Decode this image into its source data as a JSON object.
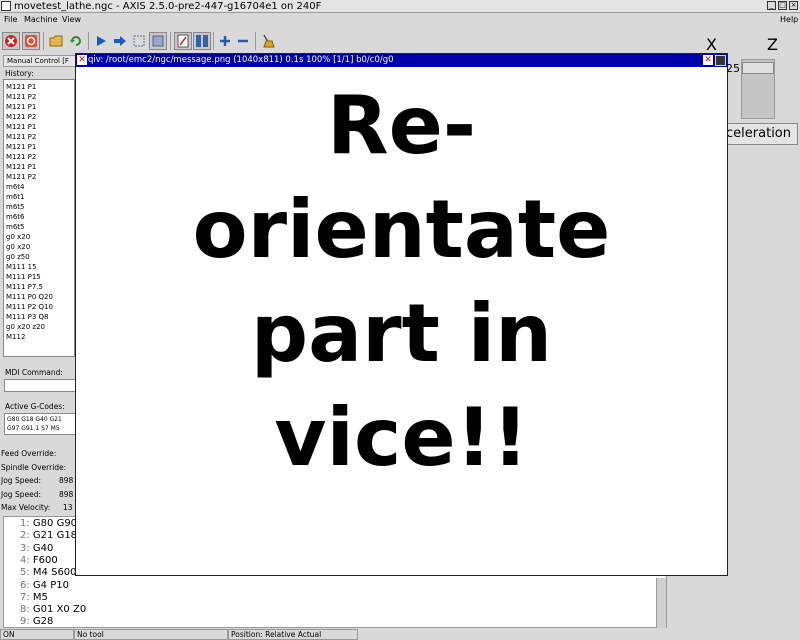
{
  "window": {
    "title": "movetest_lathe.ngc - AXIS 2.5.0-pre2-447-g16704e1 on 240F"
  },
  "menu": {
    "file": "File",
    "machine": "Machine",
    "view": "View",
    "help": "Help"
  },
  "axes_header": {
    "x": "X",
    "z": "Z"
  },
  "left": {
    "tab_label": "Manual Control [F",
    "history_label": "History:",
    "history": [
      "M121 P1",
      "M121 P2",
      "M121 P1",
      "M121 P2",
      "M121 P1",
      "M121 P2",
      "M121 P1",
      "M121 P2",
      "M121 P1",
      "M121 P2",
      "m6t4",
      "m6t1",
      "m6t5",
      "m6t6",
      "m6t5",
      "g0 x20",
      "g0 x20",
      "g0 z50",
      "M111 15",
      "M111 P15",
      "M111 P7.5",
      "M111 P0 Q20",
      "M111 P2 Q10",
      "M111 P3 Q8",
      "g0 x20 z20",
      "M112"
    ],
    "mdi_label": "MDI Command:",
    "mdi_value": "",
    "active_gcodes_label": "Active G-Codes:",
    "active_gcodes_line1": "G80 G18 G40 G21",
    "active_gcodes_line2": "G97 G91.1 S7 M5"
  },
  "overrides": {
    "feed": "Feed Override:",
    "spindle": "Spindle Override:",
    "jog1_label": "Jog Speed:",
    "jog1_value": "898",
    "jog2_label": "Jog Speed:",
    "jog2_value": "898",
    "maxvel_label": "Max Velocity:",
    "maxvel_value": "13"
  },
  "gcode": [
    {
      "n": "1:",
      "text": "G80 G90"
    },
    {
      "n": "2:",
      "text": "G21 G18"
    },
    {
      "n": "3:",
      "text": "G40"
    },
    {
      "n": "4:",
      "text": "F600"
    },
    {
      "n": "5:",
      "text": "M4 S600"
    },
    {
      "n": "6:",
      "text": "G4 P10"
    },
    {
      "n": "7:",
      "text": "M5"
    },
    {
      "n": "8:",
      "text": "G01 X0 Z0"
    },
    {
      "n": "9:",
      "text": "G28"
    }
  ],
  "status": {
    "state": "ON",
    "tool": "No tool",
    "position": "Position: Relative Actual"
  },
  "right": {
    "slider_value": "25",
    "accel_label": "celeration"
  },
  "qiv": {
    "title": "qiv: /root/emc2/ngc/message.png (1040x811) 0.1s 100% [1/1] b0/c0/g0",
    "message_lines": [
      "Re-",
      "orientate",
      "part in",
      "vice!!"
    ]
  },
  "colors": {
    "qiv_titlebar": "#0000a8",
    "estop_red": "#d02020"
  }
}
